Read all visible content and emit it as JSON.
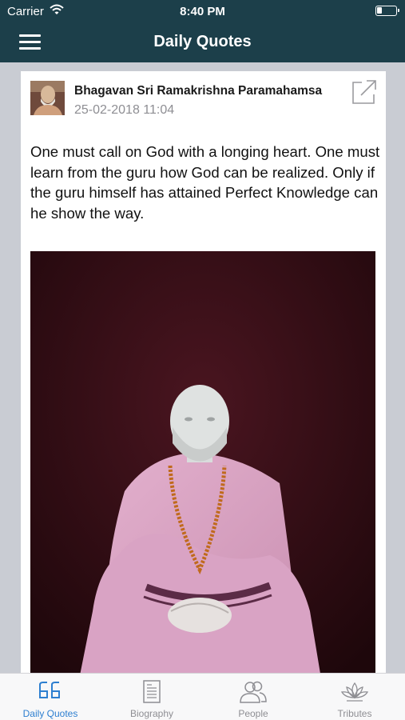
{
  "status_bar": {
    "carrier": "Carrier",
    "time": "8:40 PM",
    "icons": [
      "wifi-icon",
      "battery-icon"
    ]
  },
  "nav": {
    "title": "Daily Quotes",
    "menu_icon": "hamburger-menu-icon"
  },
  "post": {
    "author": "Bhagavan Sri Ramakrishna Paramahamsa",
    "date": "25-02-2018 11:04",
    "quote": "One must call on God with a longing heart. One must learn from the guru how God can be realized. Only if the guru himself has attained Perfect Knowledge can he show the way.",
    "share_icon": "share-icon",
    "image": "statue-photo"
  },
  "tabs": [
    {
      "label": "Daily Quotes",
      "icon": "quote-icon",
      "active": true
    },
    {
      "label": "Biography",
      "icon": "document-icon",
      "active": false
    },
    {
      "label": "People",
      "icon": "people-icon",
      "active": false
    },
    {
      "label": "Tributes",
      "icon": "lotus-icon",
      "active": false
    }
  ],
  "colors": {
    "header": "#1c3f4a",
    "active_tab": "#2d7fd0",
    "inactive_tab": "#8e8e93",
    "background": "#c9ccd3"
  }
}
